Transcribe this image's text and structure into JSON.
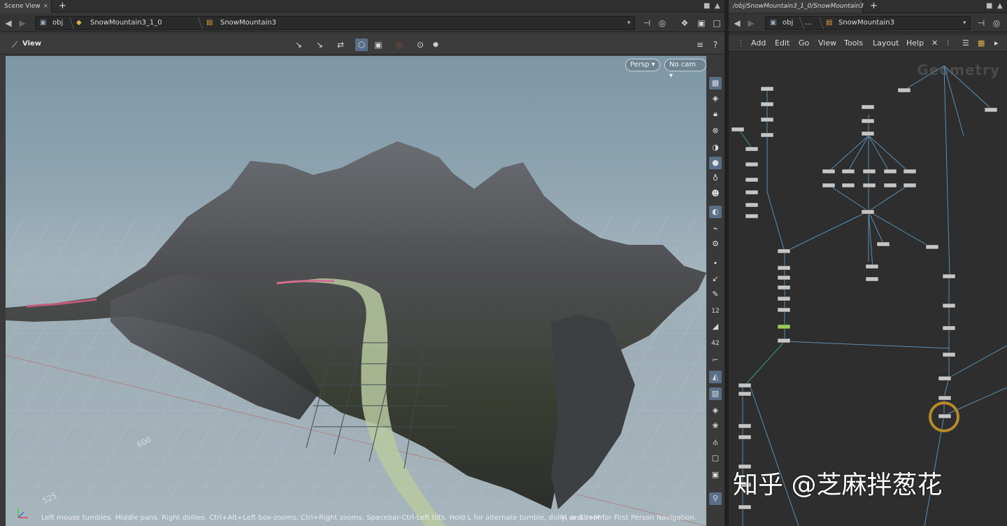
{
  "scene_view": {
    "tab_label": "Scene View",
    "tab_close": "×",
    "new_tab": "+",
    "path": [
      {
        "label": "obj",
        "icon": "obj-icon"
      },
      {
        "label": "SnowMountain3_1_0",
        "icon": "subnet-icon"
      },
      {
        "label": "SnowMountain3",
        "icon": "geo-icon"
      }
    ],
    "view_title": "View",
    "persp_label": "Persp",
    "cam_label": "No cam",
    "status_text": "Left mouse tumbles. Middle pans. Right dollies. Ctrl+Alt+Left box-zooms. Ctrl+Right zooms. Spacebar-Ctrl-Left tilts. Hold L for alternate tumble, dolly, and zoom.",
    "status_text2": "M or Alt+M for First Person Navigation.",
    "grid_labels": [
      "600",
      "525"
    ]
  },
  "network_view": {
    "tab_label": "/obj/SnowMountain3_1_0/SnowMountain3",
    "tab_close": "×",
    "new_tab": "+",
    "path": [
      {
        "label": "obj",
        "icon": "obj-icon"
      },
      {
        "label": "...",
        "icon": ""
      },
      {
        "label": "SnowMountain3",
        "icon": "geo-icon"
      }
    ],
    "menus": [
      "Add",
      "Edit",
      "Go",
      "View",
      "Tools",
      "Layout",
      "Help"
    ],
    "context_label": "Geometry"
  },
  "watermark": "知乎 @芝麻拌葱花",
  "colors": {
    "accent": "#5a6e88",
    "wire": "#5b8fb3",
    "wire_green": "#3aa06a",
    "selected_ring": "#b58a2a"
  }
}
